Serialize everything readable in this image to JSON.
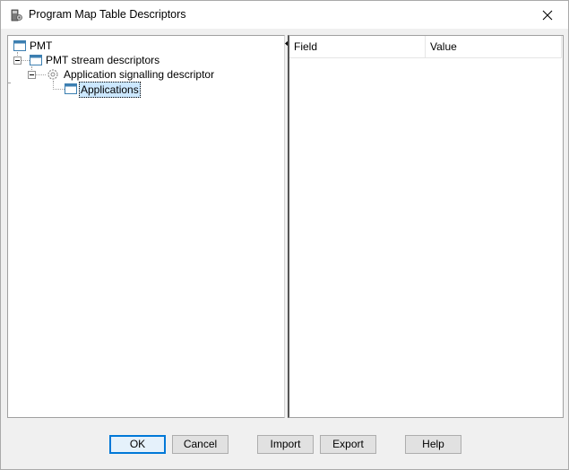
{
  "window": {
    "title": "Program Map Table Descriptors"
  },
  "tree": {
    "nodes": [
      {
        "label": "PMT",
        "icon": "table-window-icon"
      },
      {
        "label": "PMT stream descriptors",
        "icon": "table-window-icon"
      },
      {
        "label": "Application signalling descriptor",
        "icon": "gear-icon"
      },
      {
        "label": "Applications",
        "icon": "table-window-icon",
        "selected": true
      }
    ]
  },
  "list": {
    "columns": [
      "Field",
      "Value"
    ]
  },
  "buttons": {
    "ok": "OK",
    "cancel": "Cancel",
    "import": "Import",
    "export": "Export",
    "help": "Help"
  },
  "colors": {
    "selection_bg": "#cce8ff",
    "default_button_border": "#0078d7",
    "icon_blue": "#3c7fb1"
  }
}
